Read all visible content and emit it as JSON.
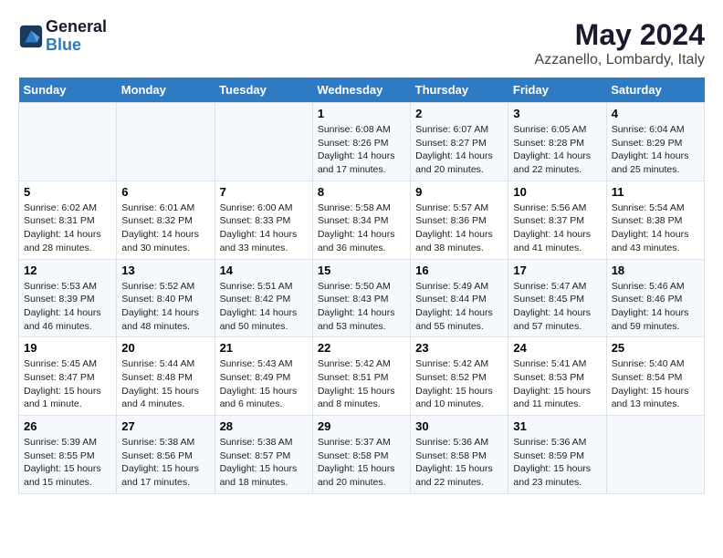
{
  "header": {
    "logo_line1": "General",
    "logo_line2": "Blue",
    "title": "May 2024",
    "subtitle": "Azzanello, Lombardy, Italy"
  },
  "weekdays": [
    "Sunday",
    "Monday",
    "Tuesday",
    "Wednesday",
    "Thursday",
    "Friday",
    "Saturday"
  ],
  "weeks": [
    [
      {
        "day": "",
        "text": ""
      },
      {
        "day": "",
        "text": ""
      },
      {
        "day": "",
        "text": ""
      },
      {
        "day": "1",
        "text": "Sunrise: 6:08 AM\nSunset: 8:26 PM\nDaylight: 14 hours and 17 minutes."
      },
      {
        "day": "2",
        "text": "Sunrise: 6:07 AM\nSunset: 8:27 PM\nDaylight: 14 hours and 20 minutes."
      },
      {
        "day": "3",
        "text": "Sunrise: 6:05 AM\nSunset: 8:28 PM\nDaylight: 14 hours and 22 minutes."
      },
      {
        "day": "4",
        "text": "Sunrise: 6:04 AM\nSunset: 8:29 PM\nDaylight: 14 hours and 25 minutes."
      }
    ],
    [
      {
        "day": "5",
        "text": "Sunrise: 6:02 AM\nSunset: 8:31 PM\nDaylight: 14 hours and 28 minutes."
      },
      {
        "day": "6",
        "text": "Sunrise: 6:01 AM\nSunset: 8:32 PM\nDaylight: 14 hours and 30 minutes."
      },
      {
        "day": "7",
        "text": "Sunrise: 6:00 AM\nSunset: 8:33 PM\nDaylight: 14 hours and 33 minutes."
      },
      {
        "day": "8",
        "text": "Sunrise: 5:58 AM\nSunset: 8:34 PM\nDaylight: 14 hours and 36 minutes."
      },
      {
        "day": "9",
        "text": "Sunrise: 5:57 AM\nSunset: 8:36 PM\nDaylight: 14 hours and 38 minutes."
      },
      {
        "day": "10",
        "text": "Sunrise: 5:56 AM\nSunset: 8:37 PM\nDaylight: 14 hours and 41 minutes."
      },
      {
        "day": "11",
        "text": "Sunrise: 5:54 AM\nSunset: 8:38 PM\nDaylight: 14 hours and 43 minutes."
      }
    ],
    [
      {
        "day": "12",
        "text": "Sunrise: 5:53 AM\nSunset: 8:39 PM\nDaylight: 14 hours and 46 minutes."
      },
      {
        "day": "13",
        "text": "Sunrise: 5:52 AM\nSunset: 8:40 PM\nDaylight: 14 hours and 48 minutes."
      },
      {
        "day": "14",
        "text": "Sunrise: 5:51 AM\nSunset: 8:42 PM\nDaylight: 14 hours and 50 minutes."
      },
      {
        "day": "15",
        "text": "Sunrise: 5:50 AM\nSunset: 8:43 PM\nDaylight: 14 hours and 53 minutes."
      },
      {
        "day": "16",
        "text": "Sunrise: 5:49 AM\nSunset: 8:44 PM\nDaylight: 14 hours and 55 minutes."
      },
      {
        "day": "17",
        "text": "Sunrise: 5:47 AM\nSunset: 8:45 PM\nDaylight: 14 hours and 57 minutes."
      },
      {
        "day": "18",
        "text": "Sunrise: 5:46 AM\nSunset: 8:46 PM\nDaylight: 14 hours and 59 minutes."
      }
    ],
    [
      {
        "day": "19",
        "text": "Sunrise: 5:45 AM\nSunset: 8:47 PM\nDaylight: 15 hours and 1 minute."
      },
      {
        "day": "20",
        "text": "Sunrise: 5:44 AM\nSunset: 8:48 PM\nDaylight: 15 hours and 4 minutes."
      },
      {
        "day": "21",
        "text": "Sunrise: 5:43 AM\nSunset: 8:49 PM\nDaylight: 15 hours and 6 minutes."
      },
      {
        "day": "22",
        "text": "Sunrise: 5:42 AM\nSunset: 8:51 PM\nDaylight: 15 hours and 8 minutes."
      },
      {
        "day": "23",
        "text": "Sunrise: 5:42 AM\nSunset: 8:52 PM\nDaylight: 15 hours and 10 minutes."
      },
      {
        "day": "24",
        "text": "Sunrise: 5:41 AM\nSunset: 8:53 PM\nDaylight: 15 hours and 11 minutes."
      },
      {
        "day": "25",
        "text": "Sunrise: 5:40 AM\nSunset: 8:54 PM\nDaylight: 15 hours and 13 minutes."
      }
    ],
    [
      {
        "day": "26",
        "text": "Sunrise: 5:39 AM\nSunset: 8:55 PM\nDaylight: 15 hours and 15 minutes."
      },
      {
        "day": "27",
        "text": "Sunrise: 5:38 AM\nSunset: 8:56 PM\nDaylight: 15 hours and 17 minutes."
      },
      {
        "day": "28",
        "text": "Sunrise: 5:38 AM\nSunset: 8:57 PM\nDaylight: 15 hours and 18 minutes."
      },
      {
        "day": "29",
        "text": "Sunrise: 5:37 AM\nSunset: 8:58 PM\nDaylight: 15 hours and 20 minutes."
      },
      {
        "day": "30",
        "text": "Sunrise: 5:36 AM\nSunset: 8:58 PM\nDaylight: 15 hours and 22 minutes."
      },
      {
        "day": "31",
        "text": "Sunrise: 5:36 AM\nSunset: 8:59 PM\nDaylight: 15 hours and 23 minutes."
      },
      {
        "day": "",
        "text": ""
      }
    ]
  ]
}
